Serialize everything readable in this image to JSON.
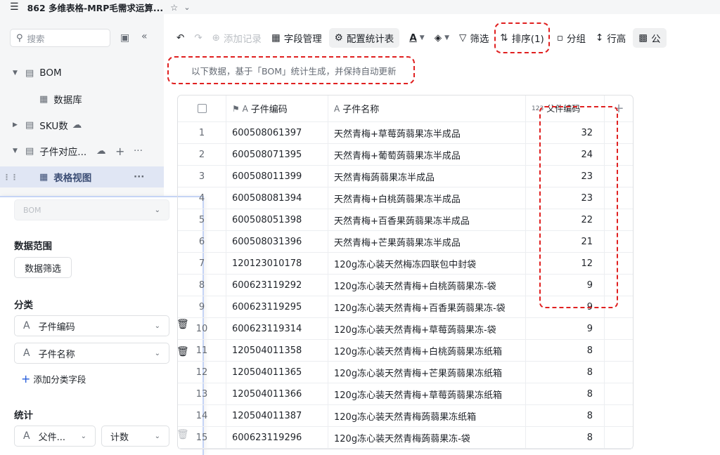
{
  "app": {
    "title": "862 多维表格-MRP毛需求运算...",
    "menu_icon": "☰",
    "star_icon": "☆",
    "caret": "⌄"
  },
  "sidebar": {
    "search_placeholder": "搜索",
    "items": [
      {
        "label": "BOM",
        "icon": "table-icon"
      },
      {
        "label": "数据库",
        "icon": "grid-icon"
      },
      {
        "label": "SKU数",
        "icon": "table-icon"
      },
      {
        "label": "子件对应...",
        "icon": "table-icon"
      },
      {
        "label": "表格视图",
        "icon": "grid-icon"
      }
    ],
    "more": "···",
    "plus": "+"
  },
  "panel": {
    "source_select": "BOM",
    "data_range_title": "数据范围",
    "data_filter_button": "数据筛选",
    "group_title": "分类",
    "group_fields": [
      "子件编码",
      "子件名称"
    ],
    "add_group_field": "添加分类字段",
    "stats_title": "统计",
    "stat_field": "父件...",
    "stat_method": "计数"
  },
  "toolbar": {
    "add_record": "添加记录",
    "field_manage": "字段管理",
    "config_stats": "配置统计表",
    "filter": "筛选",
    "sort": "排序(1)",
    "group": "分组",
    "row_height": "行高",
    "more_cut": "公"
  },
  "notice": "以下数据，基于「BOM」统计生成，并保持自动更新",
  "table": {
    "headers": {
      "code": "子件编码",
      "name": "子件名称",
      "count": "父件编码",
      "count_prefix": "123"
    },
    "rows": [
      {
        "idx": "1",
        "code": "600508061397",
        "name": "天然青梅+草莓蒟蒻果冻半成品",
        "count": "32"
      },
      {
        "idx": "2",
        "code": "600508071395",
        "name": "天然青梅+葡萄蒟蒻果冻半成品",
        "count": "24"
      },
      {
        "idx": "3",
        "code": "600508011399",
        "name": "天然青梅蒟蒻果冻半成品",
        "count": "23"
      },
      {
        "idx": "4",
        "code": "600508081394",
        "name": "天然青梅+白桃蒟蒻果冻半成品",
        "count": "23"
      },
      {
        "idx": "5",
        "code": "600508051398",
        "name": "天然青梅+百香果蒟蒻果冻半成品",
        "count": "22"
      },
      {
        "idx": "6",
        "code": "600508031396",
        "name": "天然青梅+芒果蒟蒻果冻半成品",
        "count": "21"
      },
      {
        "idx": "7",
        "code": "120123010178",
        "name": "120g冻心装天然梅冻四联包中封袋",
        "count": "12"
      },
      {
        "idx": "8",
        "code": "600623119292",
        "name": "120g冻心装天然青梅+白桃蒟蒻果冻-袋",
        "count": "9"
      },
      {
        "idx": "9",
        "code": "600623119295",
        "name": "120g冻心装天然青梅+百香果蒟蒻果冻-袋",
        "count": "9"
      },
      {
        "idx": "10",
        "code": "600623119314",
        "name": "120g冻心装天然青梅+草莓蒟蒻果冻-袋",
        "count": "9"
      },
      {
        "idx": "11",
        "code": "120504011358",
        "name": "120g冻心装天然青梅+白桃蒟蒻果冻纸箱",
        "count": "8"
      },
      {
        "idx": "12",
        "code": "120504011365",
        "name": "120g冻心装天然青梅+芒果蒟蒻果冻纸箱",
        "count": "8"
      },
      {
        "idx": "13",
        "code": "120504011366",
        "name": "120g冻心装天然青梅+草莓蒟蒻果冻纸箱",
        "count": "8"
      },
      {
        "idx": "14",
        "code": "120504011387",
        "name": "120g冻心装天然青梅蒟蒻果冻纸箱",
        "count": "8"
      },
      {
        "idx": "15",
        "code": "600623119296",
        "name": "120g冻心装天然青梅蒟蒻果冻-袋",
        "count": "8"
      }
    ]
  }
}
